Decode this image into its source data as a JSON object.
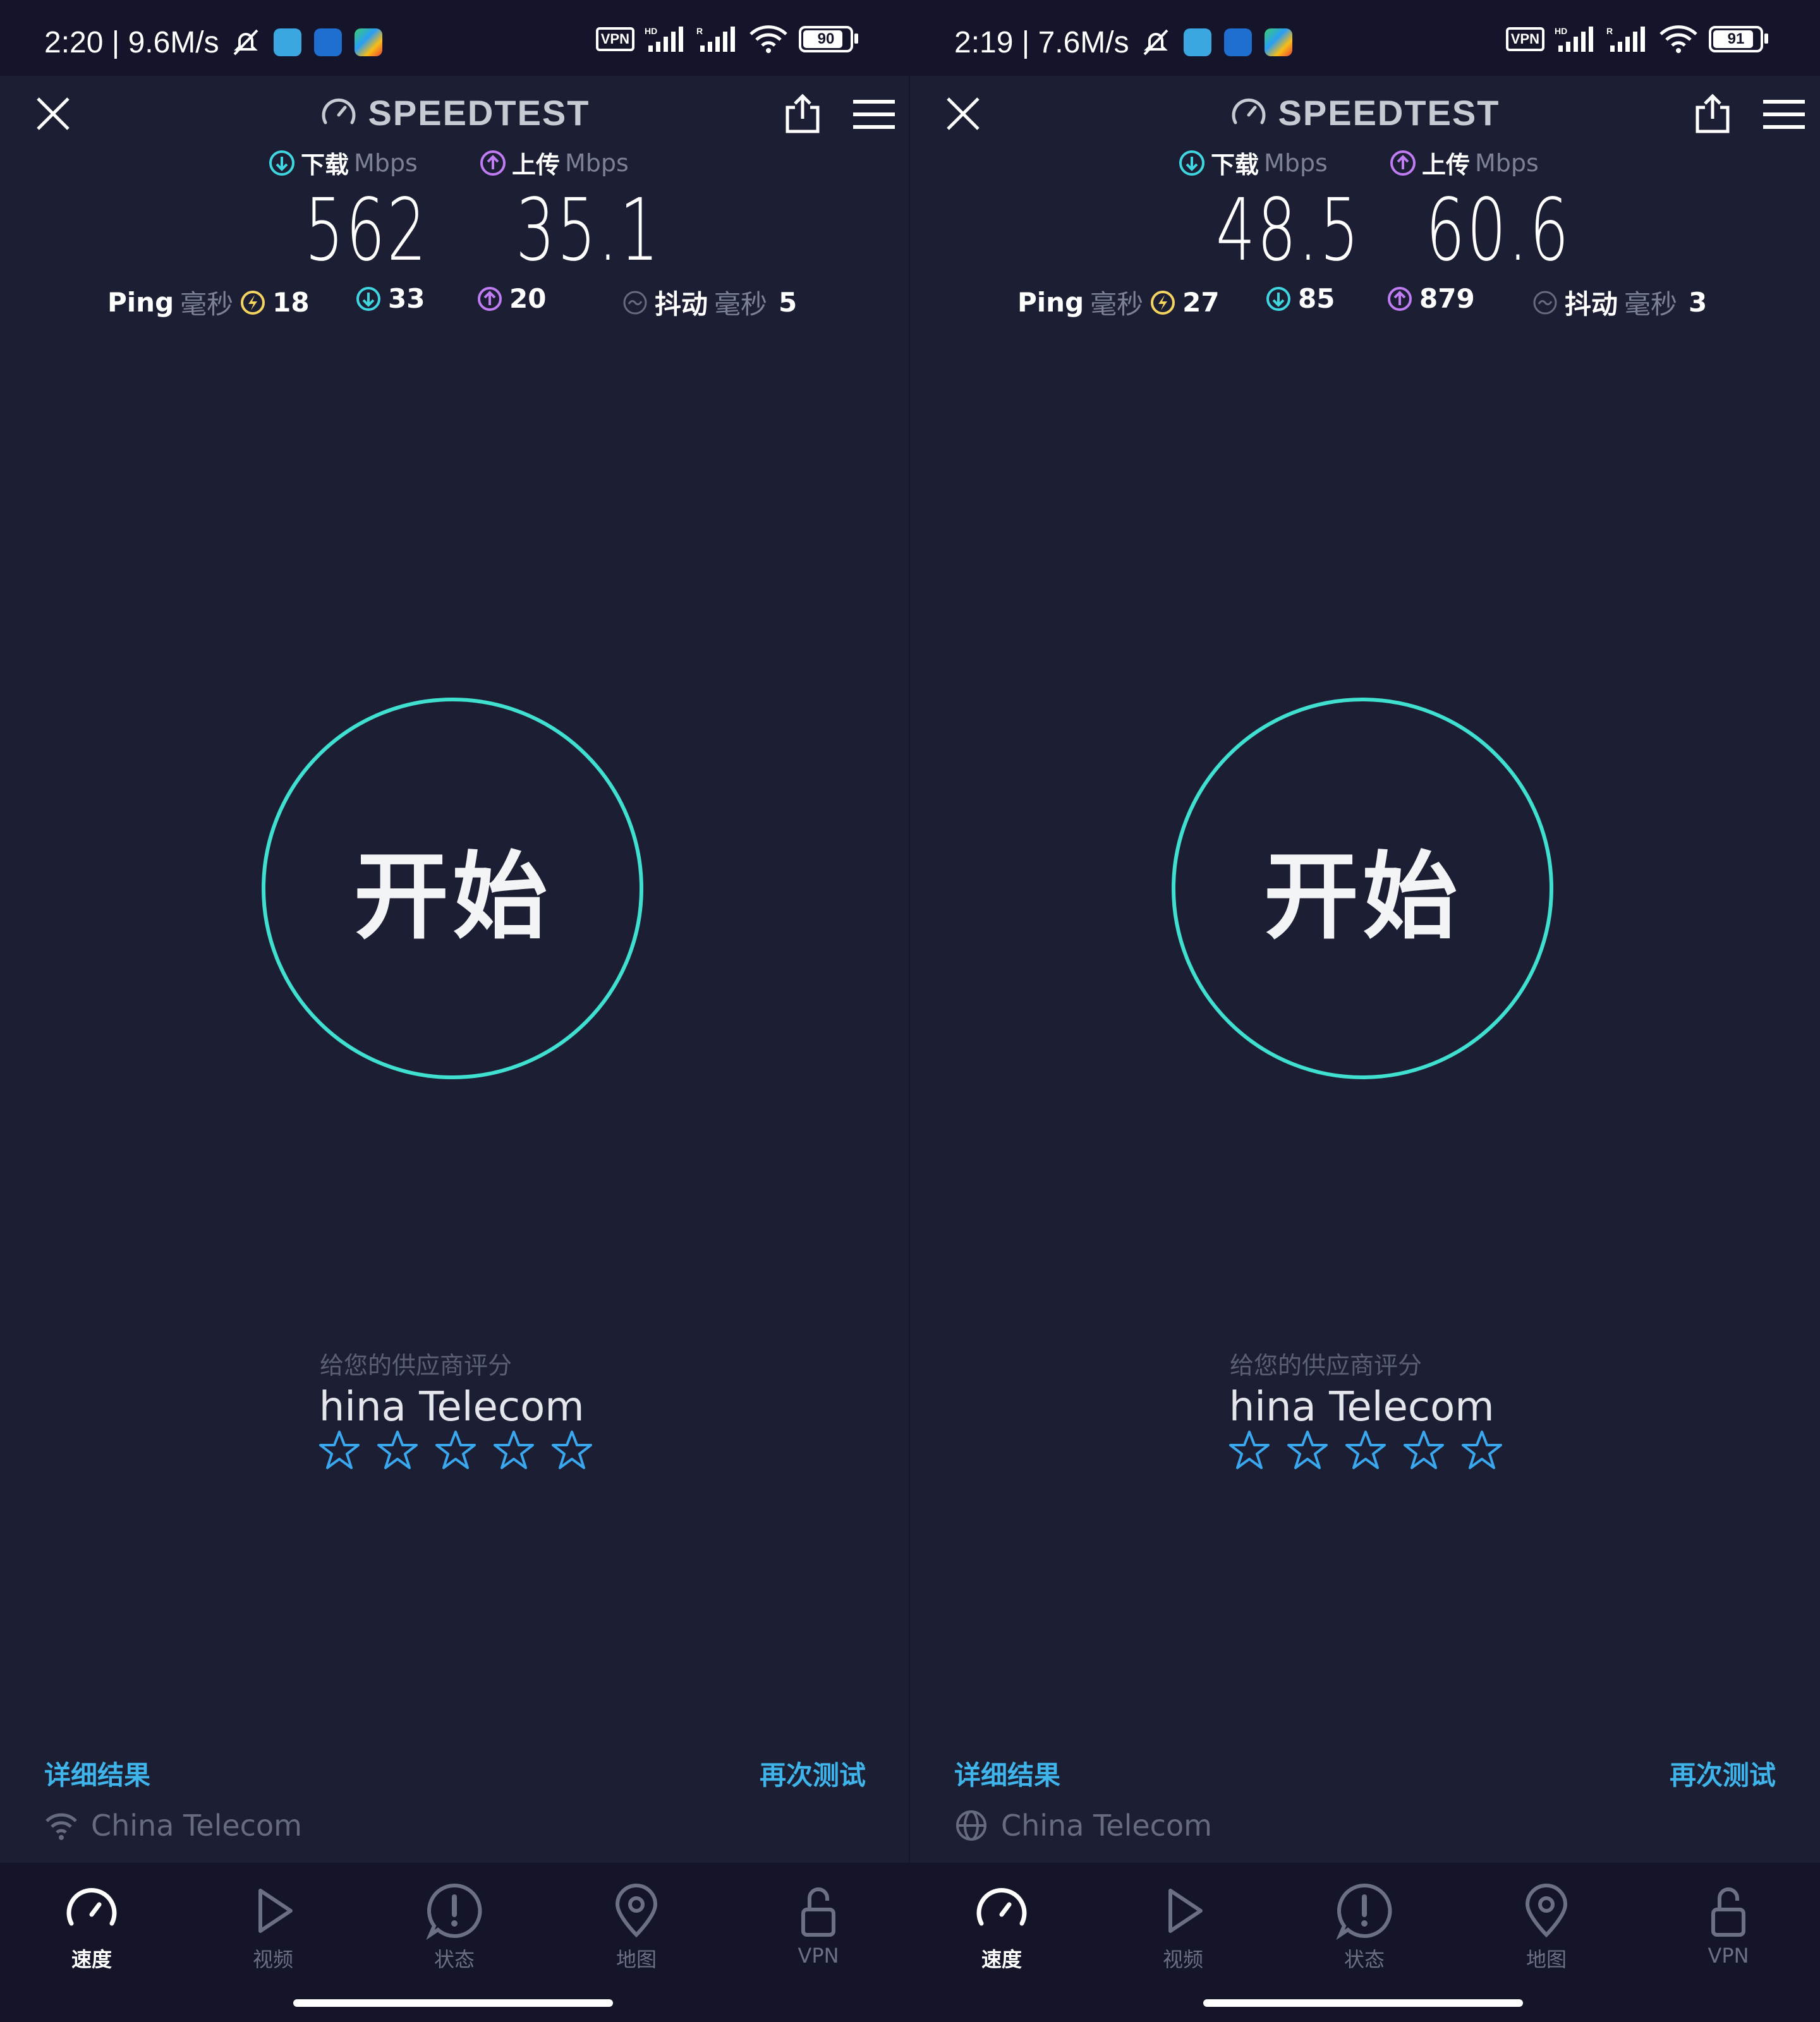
{
  "colors": {
    "background": "#1c1e34",
    "accent_cyan": "#3fe0cf",
    "download": "#3fd6e0",
    "upload": "#c07cf2",
    "ping_yellow": "#f4d35e",
    "link_blue": "#3fb4ea",
    "star_blue": "#3aa8ee"
  },
  "panels": [
    {
      "status": {
        "time_speed": "2:20 | 9.6M/s",
        "battery": "90",
        "vpn": "VPN",
        "hd": "HD",
        "roaming": "R"
      },
      "header": {
        "brand": "SPEEDTEST"
      },
      "download": {
        "label": "下载",
        "unit": "Mbps",
        "value": "562"
      },
      "upload": {
        "label": "上传",
        "unit": "Mbps",
        "value": "35.1"
      },
      "ping": {
        "label": "Ping",
        "unit": "毫秒",
        "idle": "18",
        "down": "33",
        "up": "20"
      },
      "jitter": {
        "label": "抖动",
        "unit": "毫秒",
        "value": "5"
      },
      "start_label": "开始",
      "rating": {
        "prompt": "给您的供应商评分",
        "provider": "China Telecom",
        "stars_filled": 0,
        "stars_total": 5
      },
      "links": {
        "details": "详细结果",
        "retest": "再次测试"
      },
      "connection": {
        "icon": "wifi-icon",
        "provider": "China Telecom"
      },
      "tabs": [
        {
          "label": "速度",
          "icon": "speedometer-icon",
          "active": true
        },
        {
          "label": "视频",
          "icon": "play-icon",
          "active": false
        },
        {
          "label": "状态",
          "icon": "alert-icon",
          "active": false
        },
        {
          "label": "地图",
          "icon": "map-pin-icon",
          "active": false
        },
        {
          "label": "VPN",
          "icon": "lock-icon",
          "active": false
        }
      ]
    },
    {
      "status": {
        "time_speed": "2:19 | 7.6M/s",
        "battery": "91",
        "vpn": "VPN",
        "hd": "HD",
        "roaming": "R"
      },
      "header": {
        "brand": "SPEEDTEST"
      },
      "download": {
        "label": "下载",
        "unit": "Mbps",
        "value": "48.5"
      },
      "upload": {
        "label": "上传",
        "unit": "Mbps",
        "value": "60.6"
      },
      "ping": {
        "label": "Ping",
        "unit": "毫秒",
        "idle": "27",
        "down": "85",
        "up": "879"
      },
      "jitter": {
        "label": "抖动",
        "unit": "毫秒",
        "value": "3"
      },
      "start_label": "开始",
      "rating": {
        "prompt": "给您的供应商评分",
        "provider": "China Telecom",
        "stars_filled": 0,
        "stars_total": 5
      },
      "links": {
        "details": "详细结果",
        "retest": "再次测试"
      },
      "connection": {
        "icon": "globe-icon",
        "provider": "China Telecom"
      },
      "tabs": [
        {
          "label": "速度",
          "icon": "speedometer-icon",
          "active": true
        },
        {
          "label": "视频",
          "icon": "play-icon",
          "active": false
        },
        {
          "label": "状态",
          "icon": "alert-icon",
          "active": false
        },
        {
          "label": "地图",
          "icon": "map-pin-icon",
          "active": false
        },
        {
          "label": "VPN",
          "icon": "lock-icon",
          "active": false
        }
      ]
    }
  ]
}
